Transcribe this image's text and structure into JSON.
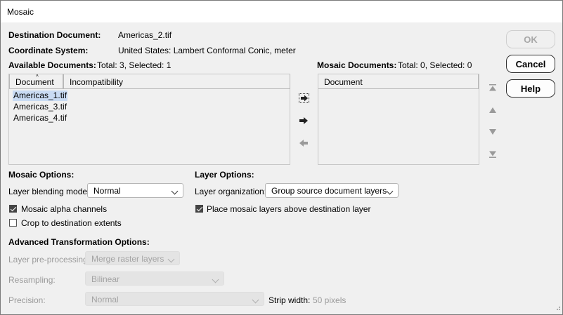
{
  "window": {
    "title": "Mosaic"
  },
  "dest_doc": {
    "label": "Destination Document:",
    "value": "Americas_2.tif"
  },
  "coord_sys": {
    "label": "Coordinate System:",
    "value": "United States: Lambert Conformal Conic, meter"
  },
  "available": {
    "label": "Available Documents:",
    "summary": "Total: 3, Selected: 1",
    "col_document": "Document",
    "col_incompat": "Incompatibility",
    "items": [
      "Americas_1.tif",
      "Americas_3.tif",
      "Americas_4.tif"
    ]
  },
  "mosaic_docs": {
    "label": "Mosaic Documents:",
    "summary": "Total: 0, Selected: 0",
    "col_document": "Document"
  },
  "buttons": {
    "ok": "OK",
    "cancel": "Cancel",
    "help": "Help"
  },
  "mosaic_options": {
    "heading": "Mosaic Options:",
    "blend_label": "Layer blending mode:",
    "blend_value": "Normal",
    "alpha_label": "Mosaic alpha channels",
    "alpha_checked": true,
    "crop_label": "Crop to destination extents",
    "crop_checked": false
  },
  "layer_options": {
    "heading": "Layer Options:",
    "org_label": "Layer organization:",
    "org_value": "Group source document layers",
    "place_label": "Place mosaic layers above destination layer",
    "place_checked": true
  },
  "advanced": {
    "heading": "Advanced Transformation Options:",
    "preproc_label": "Layer pre-processing",
    "preproc_value": "Merge raster layers",
    "resampling_label": "Resampling:",
    "resampling_value": "Bilinear",
    "precision_label": "Precision:",
    "precision_value": "Normal",
    "strip_label": "Strip width:",
    "strip_value": "50 pixels"
  },
  "colors": {
    "selection": "#c9dbf3",
    "window_bg": "#f0f0f0"
  }
}
